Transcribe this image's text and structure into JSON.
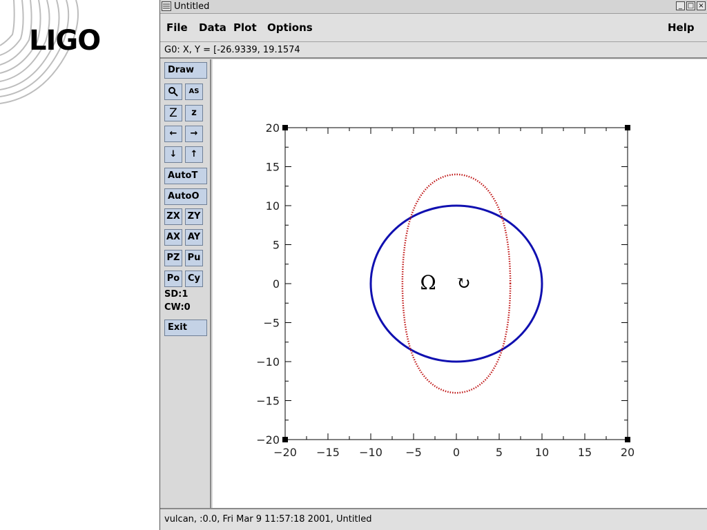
{
  "logo": {
    "text": "LIGO"
  },
  "window": {
    "title": "Untitled",
    "controls": [
      "_",
      "□",
      "×"
    ]
  },
  "menubar": {
    "items": [
      "File",
      "Data",
      "Plot",
      "Options"
    ],
    "help": "Help"
  },
  "coord_readout": "G0: X, Y = [-26.9339, 19.1574",
  "toolbar": {
    "draw": "Draw",
    "zoom_icon": "magnifier-icon",
    "autoscale_icon": "AS",
    "zoom_in": "Z",
    "zoom_out": "z",
    "left": "←",
    "right": "→",
    "down": "↓",
    "up": "↑",
    "autot": "AutoT",
    "autoo": "AutoO",
    "zx": "ZX",
    "zy": "ZY",
    "ax": "AX",
    "ay": "AY",
    "pz": "PZ",
    "pu": "Pu",
    "po": "Po",
    "cy": "Cy",
    "sd": "SD:1",
    "cw": "CW:0",
    "exit": "Exit"
  },
  "status": "vulcan, :0.0, Fri Mar  9 11:57:18 2001, Untitled",
  "chart_data": {
    "type": "line",
    "xlim": [
      -20,
      20
    ],
    "ylim": [
      -20,
      20
    ],
    "xticks": [
      "−20",
      "−15",
      "−10",
      "−5",
      "0",
      "5",
      "10",
      "15",
      "20"
    ],
    "yticks": [
      "20",
      "15",
      "10",
      "5",
      "0",
      "−5",
      "−10",
      "−15",
      "−20"
    ],
    "annotations": [
      "Ω",
      "↻"
    ],
    "series": [
      {
        "shape": "circle",
        "radius": 10,
        "center": [
          0,
          0
        ],
        "color": "#1010b0",
        "style": "solid"
      },
      {
        "shape": "peanut",
        "rx_min": 6.3,
        "rx_max": 7.4,
        "ry": 14,
        "color": "#c01818",
        "style": "dotted"
      }
    ]
  }
}
